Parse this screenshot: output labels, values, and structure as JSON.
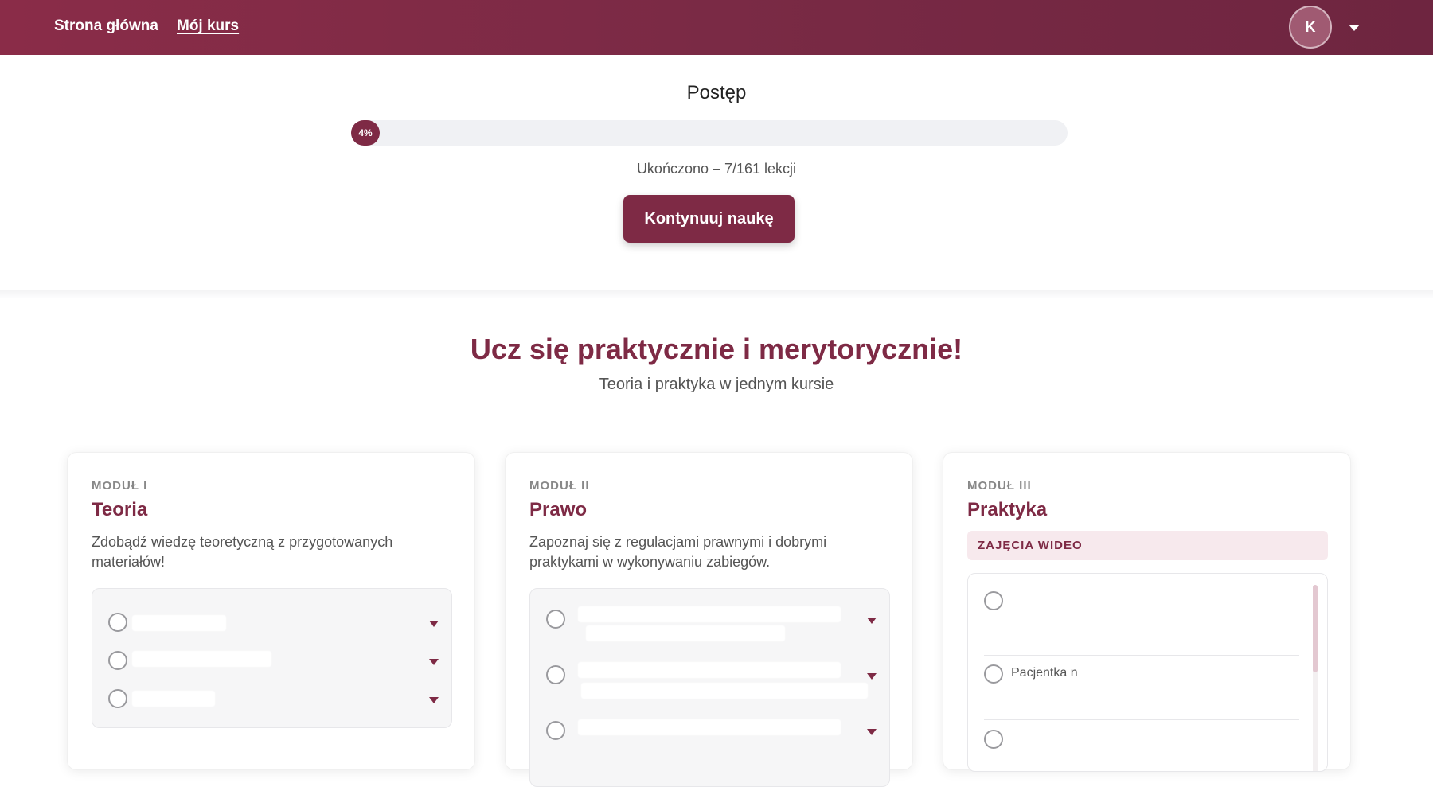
{
  "nav": {
    "home_label": "Strona główna",
    "course_label": "Mój kurs",
    "avatar_initial": "K"
  },
  "progress": {
    "title": "Postęp",
    "percent": 4,
    "percent_label": "4%",
    "caption": "Ukończono – 7/161 lekcji",
    "continue_label": "Kontynuuj naukę"
  },
  "intro": {
    "headline": "Ucz się praktycznie i merytorycznie!",
    "subheadline": "Teoria i praktyka w jednym kursie"
  },
  "modules": [
    {
      "label": "MODUŁ I",
      "title": "Teoria",
      "description": "Zdobądź wiedzę teoretyczną z przygotowanych materiałów!"
    },
    {
      "label": "MODUŁ II",
      "title": "Prawo",
      "description": "Zapoznaj się z regulacjami prawnymi i dobrymi praktykami w wykonywaniu zabiegów."
    },
    {
      "label": "MODUŁ III",
      "title": "Praktyka",
      "badge": "ZAJĘCIA WIDEO",
      "visible_fragment": "Pacjentka n"
    }
  ],
  "colors": {
    "brand": "#7e2a45",
    "header_start": "#8a2c48",
    "header_end": "#6e2540",
    "badge_bg": "#f7e9ed"
  }
}
